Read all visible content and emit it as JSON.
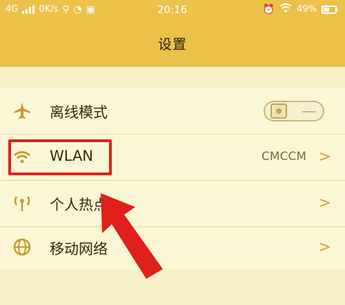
{
  "status_bar": {
    "network": "4G",
    "speed": "0K/s",
    "time": "20:16",
    "battery": "49%",
    "alarm_icon": "alarm-icon",
    "wifi_icon": "wifi-icon"
  },
  "title": "设置",
  "items": [
    {
      "label": "离线模式",
      "icon": "airplane-icon",
      "control": "toggle"
    },
    {
      "label": "WLAN",
      "icon": "wifi-icon",
      "value": "CMCCM",
      "chevron": ">"
    },
    {
      "label": "个人热点",
      "icon": "hotspot-icon",
      "chevron": ">"
    },
    {
      "label": "移动网络",
      "icon": "globe-icon",
      "chevron": ">"
    }
  ],
  "colors": {
    "header": "#ecc14a",
    "accent": "#c49a2a",
    "highlight": "#e0201a"
  }
}
